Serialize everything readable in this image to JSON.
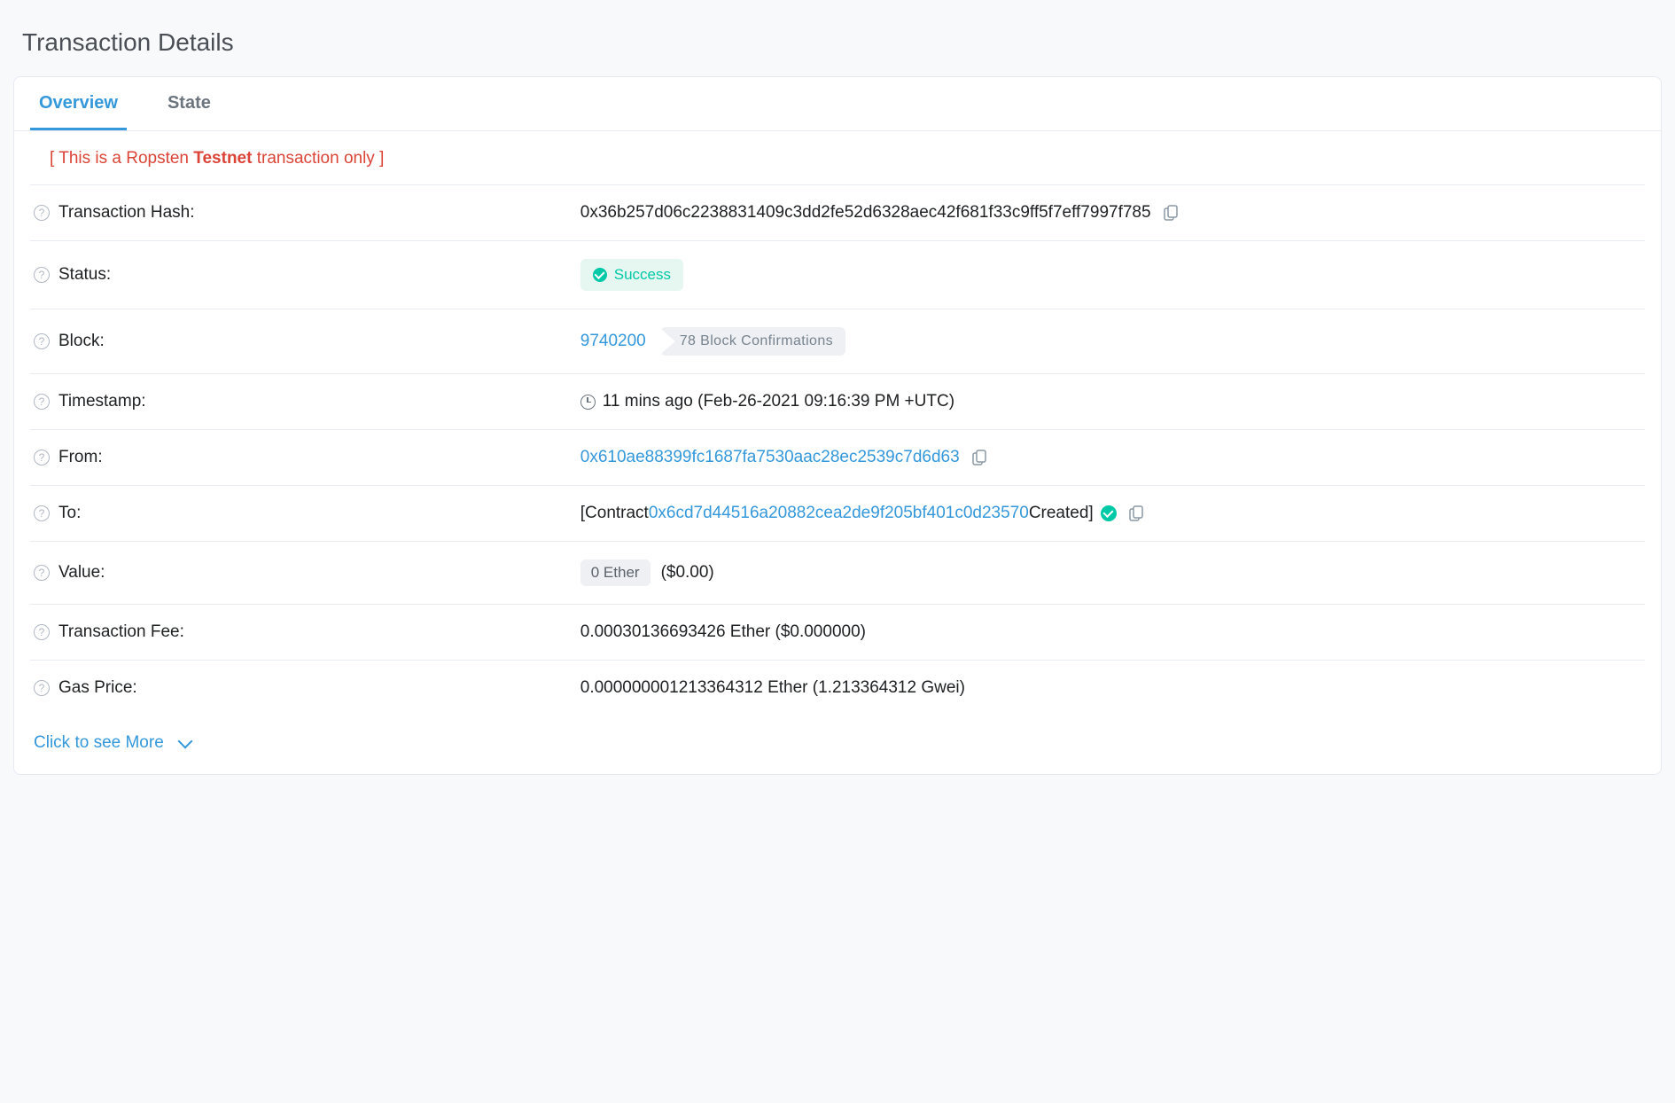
{
  "page_title": "Transaction Details",
  "tabs": {
    "overview": "Overview",
    "state": "State"
  },
  "warning": {
    "prefix": "[ This is a Ropsten ",
    "bold": "Testnet",
    "suffix": " transaction only ]"
  },
  "labels": {
    "hash": "Transaction Hash:",
    "status": "Status:",
    "block": "Block:",
    "timestamp": "Timestamp:",
    "from": "From:",
    "to": "To:",
    "value": "Value:",
    "fee": "Transaction Fee:",
    "gas_price": "Gas Price:"
  },
  "values": {
    "hash": "0x36b257d06c2238831409c3dd2fe52d6328aec42f681f33c9ff5f7eff7997f785",
    "status": "Success",
    "block": "9740200",
    "confirmations": "78 Block Confirmations",
    "timestamp": "11 mins ago (Feb-26-2021 09:16:39 PM +UTC)",
    "from": "0x610ae88399fc1687fa7530aac28ec2539c7d6d63",
    "to_prefix": "[Contract ",
    "to_address": "0x6cd7d44516a20882cea2de9f205bf401c0d23570",
    "to_suffix": " Created]",
    "value_pill": "0 Ether",
    "value_usd": "($0.00)",
    "fee": "0.00030136693426 Ether ($0.000000)",
    "gas_price": "0.000000001213364312 Ether (1.213364312 Gwei)"
  },
  "see_more": "Click to see More"
}
